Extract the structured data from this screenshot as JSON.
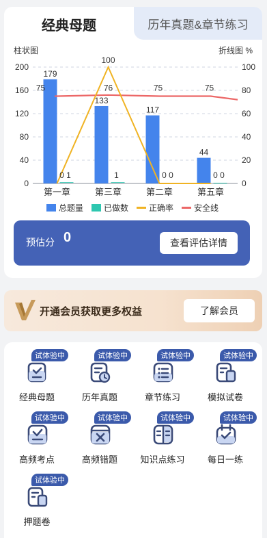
{
  "tabs": {
    "active": "经典母题",
    "inactive": "历年真题&章节练习"
  },
  "chart_data": {
    "type": "bar",
    "left_axis_title": "柱状图",
    "right_axis_title": "折线图 %",
    "categories": [
      "第一章",
      "第三章",
      "第二章",
      "第五章"
    ],
    "ylim_left": [
      0,
      200
    ],
    "ylim_right": [
      0,
      100
    ],
    "left_ticks": [
      0,
      40,
      80,
      120,
      160,
      200
    ],
    "right_ticks": [
      0,
      20,
      40,
      60,
      80,
      100
    ],
    "series": [
      {
        "name": "总题量",
        "kind": "bar",
        "axis": "left",
        "color": "#4484ec",
        "values": [
          179,
          133,
          117,
          44
        ]
      },
      {
        "name": "已做数",
        "kind": "bar",
        "axis": "left",
        "color": "#2ec7b0",
        "values": [
          1,
          1,
          0,
          0
        ]
      },
      {
        "name": "正确率",
        "kind": "line",
        "axis": "right",
        "color": "#f0b323",
        "values": [
          0,
          100,
          0,
          0
        ]
      },
      {
        "name": "安全线",
        "kind": "line",
        "axis": "right",
        "color": "#ec6767",
        "values": [
          75,
          76,
          75,
          75
        ]
      }
    ],
    "data_labels": {
      "total": [
        "179",
        "133",
        "117",
        "44"
      ],
      "done_accuracy": [
        "0 1",
        "1",
        "0 0",
        "0 0"
      ],
      "line_top": [
        "75",
        "76",
        "75",
        "75"
      ],
      "peak": "100"
    },
    "grid": true,
    "legend_position": "bottom"
  },
  "estimate": {
    "label": "预估分",
    "value": "0",
    "button": "查看评估详情"
  },
  "vip": {
    "text": "开通会员获取更多权益",
    "button": "了解会员"
  },
  "items": [
    {
      "label": "经典母题",
      "badge": "试体验中",
      "icon": "check-doc-icon"
    },
    {
      "label": "历年真题",
      "badge": "试体验中",
      "icon": "doc-clock-icon"
    },
    {
      "label": "章节练习",
      "badge": "试体验中",
      "icon": "list-icon"
    },
    {
      "label": "模拟试卷",
      "badge": "试体验中",
      "icon": "paper-icon"
    },
    {
      "label": "高频考点",
      "badge": "试体验中",
      "icon": "check-tray-icon"
    },
    {
      "label": "高频错题",
      "badge": "试体验中",
      "icon": "wrong-box-icon"
    },
    {
      "label": "知识点练习",
      "badge": "试体验中",
      "icon": "book-icon"
    },
    {
      "label": "每日一练",
      "badge": "试体验中",
      "icon": "calendar-check-icon"
    },
    {
      "label": "押题卷",
      "badge": "试体验中",
      "icon": "exam-paper-icon"
    }
  ],
  "colors": {
    "primary": "#4462b6",
    "badge": "#3b5aab",
    "icon": "#3a4a78"
  }
}
